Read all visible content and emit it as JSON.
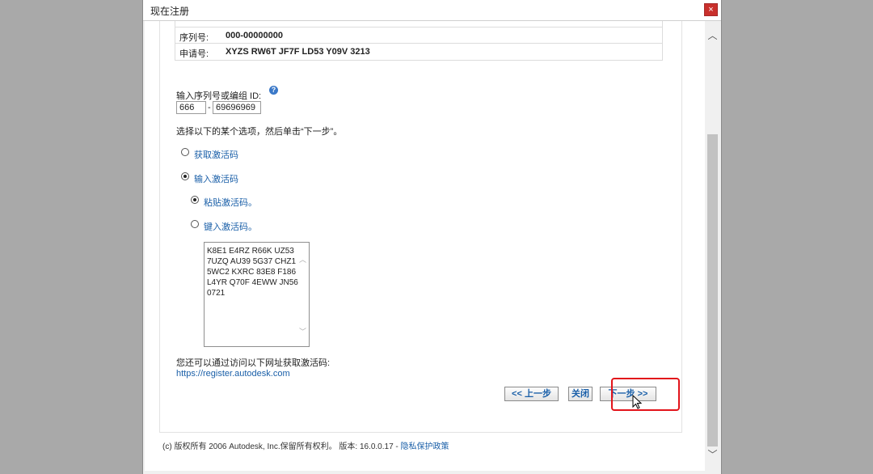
{
  "window": {
    "title": "现在注册",
    "close_glyph": "×"
  },
  "info": {
    "rows": [
      {
        "label": "序列号:",
        "value": "000-00000000"
      },
      {
        "label": "申请号:",
        "value": "XYZS RW6T JF7F LD53 Y09V 3213"
      }
    ]
  },
  "serial": {
    "label": "输入序列号或编组 ID:",
    "help_glyph": "?",
    "prefix_value": "666",
    "separator": "-",
    "number_value": "69696969"
  },
  "instruction": "选择以下的某个选项，然后单击“下一步”。",
  "options": {
    "get_code": "获取激活码",
    "enter_code": "输入激活码",
    "paste_code": "粘贴激活码。",
    "type_code": "键入激活码。"
  },
  "activation_code_lines": [
    "K8E1 E4RZ R66K UZ53",
    "7UZQ AU39 5G37 CHZ1",
    "5WC2 KXRC 83E8 F186",
    "L4YR Q70F 4EWW JN56",
    "0721"
  ],
  "alt_text": "您还可以通过访问以下网址获取激活码:",
  "alt_url": "https://register.autodesk.com",
  "buttons": {
    "back": "<< 上一步",
    "close": "关闭",
    "next": "下一步 >>"
  },
  "footer": {
    "copyright": "(c) 版权所有 2006 Autodesk, Inc.保留所有权利。 版本: 16.0.0.17 - ",
    "privacy": "隐私保护政策"
  },
  "colors": {
    "accent": "#1a5fa8",
    "highlight": "#e2141b",
    "close": "#c9302c"
  }
}
